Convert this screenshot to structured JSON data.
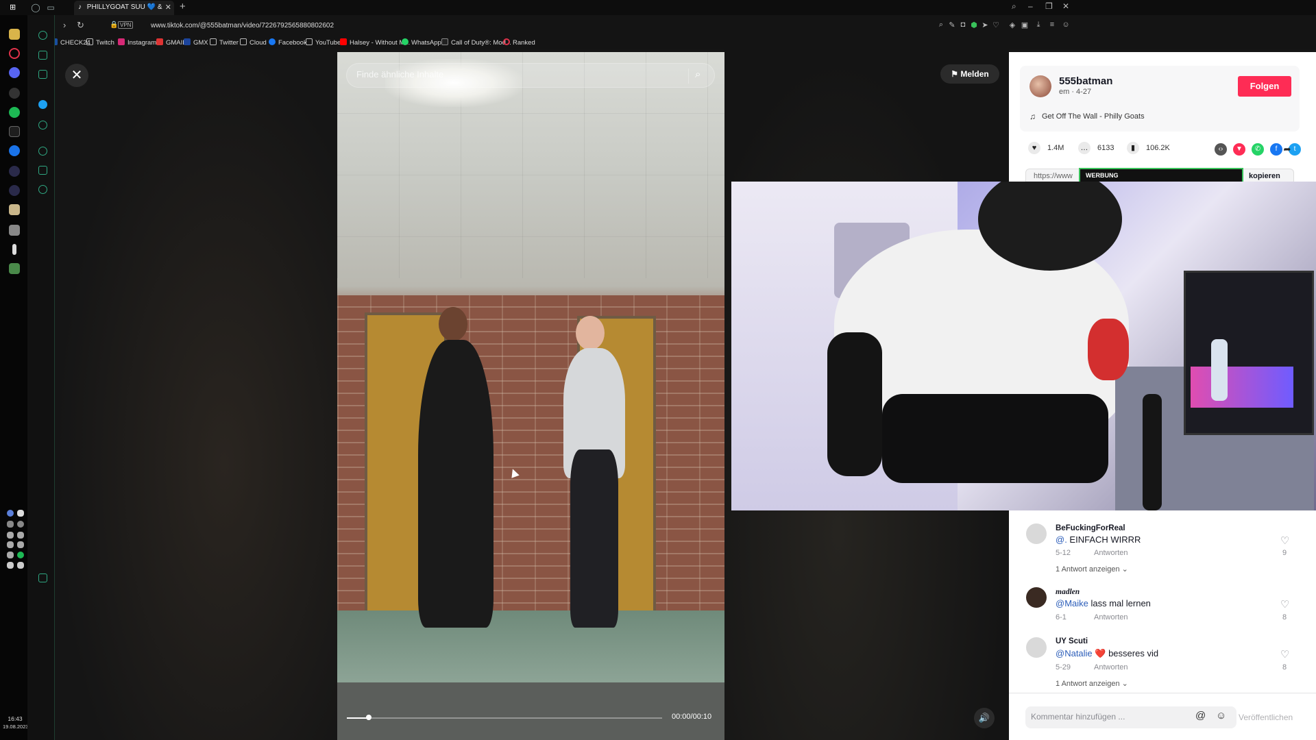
{
  "browser": {
    "tab_title": "PHILLYGOAT SUU 💙 &",
    "url": "www.tiktok.com/@555batman/video/7226792565880802602",
    "vpn_label": "VPN",
    "bookmarks": [
      "CHECK24",
      "Twitch",
      "Instagram",
      "GMAIL",
      "GMX",
      "Twitter",
      "Cloud",
      "Facebook",
      "YouTube",
      "Halsey - Without M...",
      "WhatsApp",
      "Call of Duty®: Mod...",
      "Ranked"
    ]
  },
  "clock": {
    "time": "16:43",
    "date": "19.08.2023"
  },
  "video": {
    "search_placeholder": "Finde ähnliche Inhalte",
    "report_label": "Melden",
    "time_readout": "00:00/00:10",
    "progress": 0.07
  },
  "author": {
    "name": "555batman",
    "meta": "em · 4-27",
    "follow_label": "Folgen",
    "music": "Get Off The Wall - Philly Goats"
  },
  "stats": {
    "likes": "1.4M",
    "comments": "6133",
    "bookmarks": "106.2K"
  },
  "share_icons": [
    {
      "name": "embed-icon",
      "color": "#555555",
      "glyph": "‹›"
    },
    {
      "name": "send-friends-icon",
      "color": "#fe2c55",
      "glyph": "▼"
    },
    {
      "name": "whatsapp-icon",
      "color": "#25d366",
      "glyph": "✆"
    },
    {
      "name": "facebook-icon",
      "color": "#1877f2",
      "glyph": "f"
    },
    {
      "name": "twitter-icon",
      "color": "#1da1f2",
      "glyph": "t"
    }
  ],
  "link": {
    "url": "https://www",
    "copy_label": "kopieren"
  },
  "ad_banner": "WERBUNG",
  "comments": [
    {
      "user": "BeFuckingForReal",
      "mention": "@.",
      "text": " EINFACH WIRRR",
      "date": "5-12",
      "reply_label": "Antworten",
      "more": "1 Antwort anzeigen ⌄",
      "likes": "9"
    },
    {
      "user": "madlen",
      "mention": "@Maike",
      "text": " lass mal lernen",
      "date": "6-1",
      "reply_label": "Antworten",
      "more": "",
      "likes": "8"
    },
    {
      "user": "UY Scuti",
      "mention": "@Natalie",
      "text": " ❤️ besseres vid",
      "date": "5-29",
      "reply_label": "Antworten",
      "more": "1 Antwort anzeigen ⌄",
      "likes": "8"
    }
  ],
  "composer": {
    "placeholder": "Kommentar hinzufügen ...",
    "post_label": "Veröffentlichen"
  },
  "colors": {
    "accent": "#fe2c55",
    "sidebar_accent": "#2fa882"
  }
}
